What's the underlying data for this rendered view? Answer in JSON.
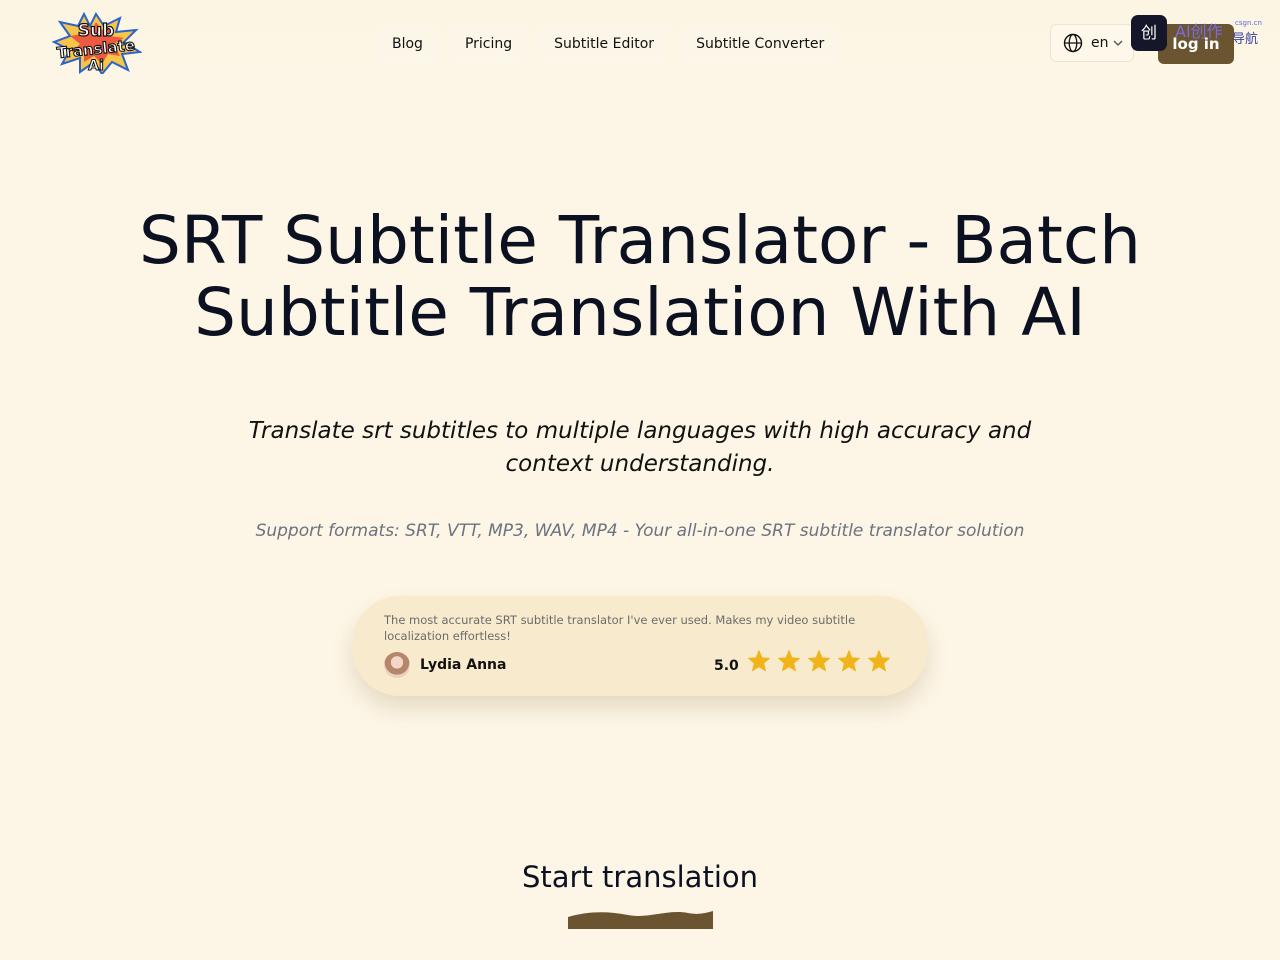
{
  "brand": {
    "logo_words": [
      "Sub",
      "Translate",
      "Ai"
    ]
  },
  "nav": {
    "items": [
      {
        "label": "Blog"
      },
      {
        "label": "Pricing"
      },
      {
        "label": "Subtitle Editor"
      },
      {
        "label": "Subtitle Converter"
      }
    ]
  },
  "language": {
    "value": "en"
  },
  "login": {
    "label": "log in"
  },
  "overlay_badge": {
    "icon_char": "创",
    "text": "AI创作",
    "domain": "csgn.cn",
    "label": "导航"
  },
  "hero": {
    "title_line1": "SRT Subtitle Translator - Batch",
    "title_line2": "Subtitle Translation With AI",
    "subtitle": "Translate srt subtitles to multiple languages with high accuracy and context understanding.",
    "formats": "Support formats: SRT, VTT, MP3, WAV, MP4 - Your all-in-one SRT subtitle translator solution"
  },
  "testimonial": {
    "quote": "The most accurate SRT subtitle translator I've ever used. Makes my video subtitle localization effortless!",
    "author": "Lydia Anna",
    "rating": "5.0",
    "stars": 5
  },
  "cta": {
    "title": "Start translation"
  },
  "colors": {
    "background": "#fdf6e6",
    "accent": "#6b5530",
    "star": "#f0b41a"
  }
}
